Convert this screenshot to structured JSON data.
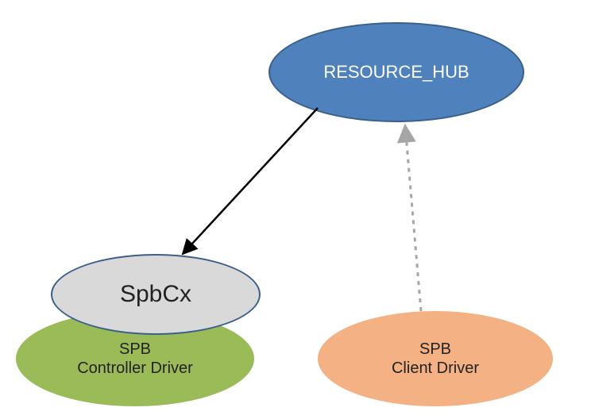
{
  "nodes": {
    "hub": {
      "label": "RESOURCE_HUB"
    },
    "spbcx": {
      "label": "SpbCx"
    },
    "controller": {
      "line1": "SPB",
      "line2": "Controller Driver"
    },
    "client": {
      "line1": "SPB",
      "line2": "Client Driver"
    }
  },
  "colors": {
    "hub_fill": "#4f81bd",
    "hub_stroke": "#3a5f8a",
    "spbcx_fill": "#d9d9d9",
    "controller_fill": "#9bbb59",
    "client_fill": "#f4b183",
    "arrow_solid": "#000000",
    "arrow_dashed": "#a6a6a6"
  },
  "edges": [
    {
      "from": "hub",
      "to": "spbcx",
      "style": "solid"
    },
    {
      "from": "client",
      "to": "hub",
      "style": "dashed"
    }
  ]
}
